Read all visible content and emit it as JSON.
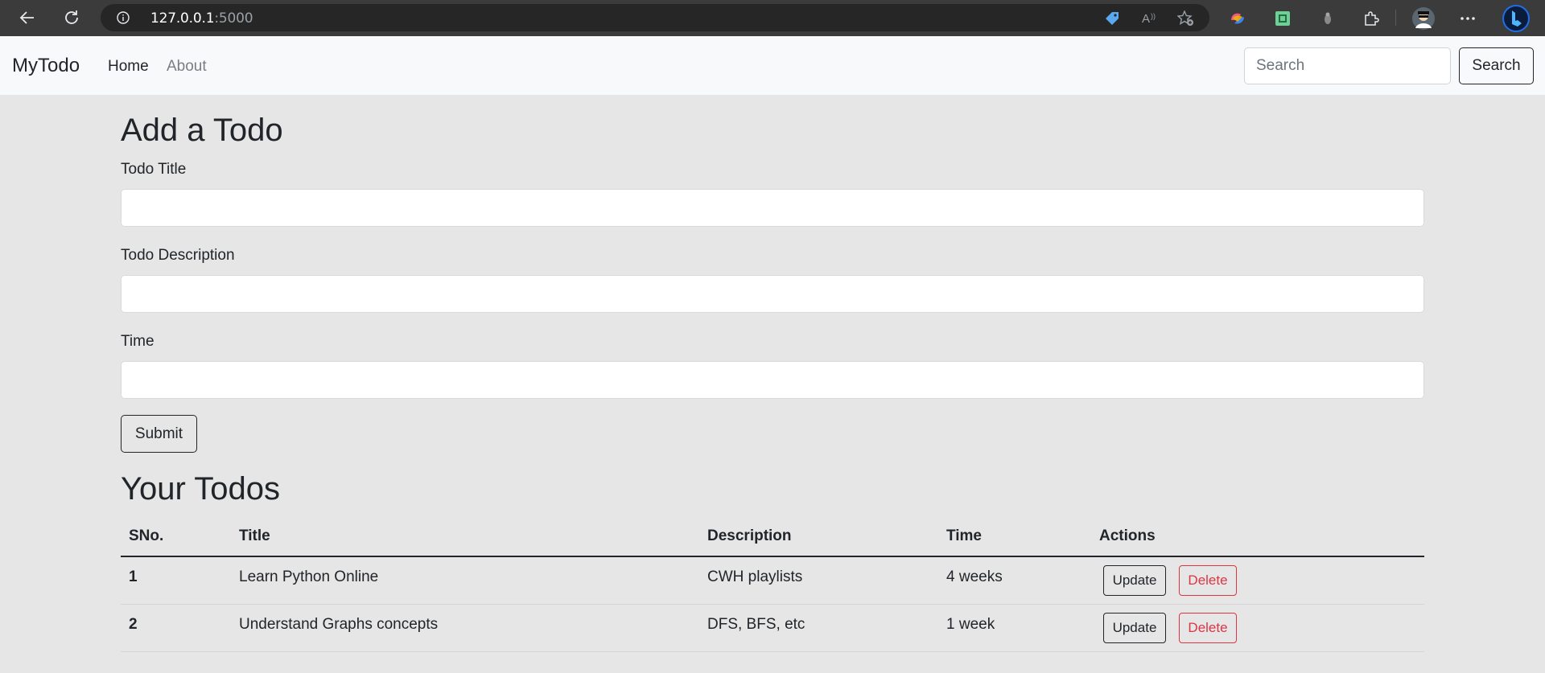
{
  "browser": {
    "url_host": "127.0.0.1",
    "url_port": ":5000",
    "icons": [
      "back-arrow-icon",
      "refresh-icon",
      "info-icon",
      "coupon-tag-icon",
      "read-aloud-icon",
      "favorite-add-icon",
      "copilot-icon",
      "collections-icon",
      "extension-icon",
      "extensions-puzzle-icon",
      "profile-avatar-icon",
      "more-icon",
      "bing-icon"
    ]
  },
  "navbar": {
    "brand": "MyTodo",
    "links": [
      {
        "label": "Home",
        "active": true
      },
      {
        "label": "About",
        "active": false
      }
    ],
    "search_placeholder": "Search",
    "search_button": "Search"
  },
  "form": {
    "heading": "Add a Todo",
    "title_label": "Todo Title",
    "title_value": "",
    "desc_label": "Todo Description",
    "desc_value": "",
    "time_label": "Time",
    "time_value": "",
    "submit_label": "Submit"
  },
  "todos": {
    "heading": "Your Todos",
    "columns": [
      "SNo.",
      "Title",
      "Description",
      "Time",
      "Actions"
    ],
    "rows": [
      {
        "sno": "1",
        "title": "Learn Python Online",
        "description": "CWH playlists",
        "time": "4 weeks",
        "update": "Update",
        "delete": "Delete"
      },
      {
        "sno": "2",
        "title": "Understand Graphs concepts",
        "description": "DFS, BFS, etc",
        "time": "1 week",
        "update": "Update",
        "delete": "Delete"
      }
    ]
  },
  "colors": {
    "danger": "#dc3545",
    "navbar_bg": "#f8f9fa",
    "page_bg": "#e6e6e6"
  }
}
